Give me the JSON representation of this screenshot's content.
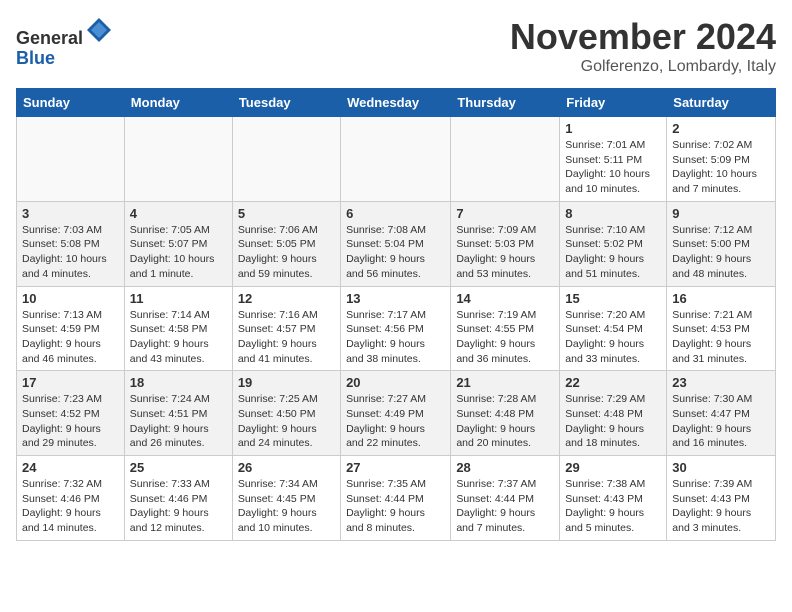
{
  "header": {
    "logo_line1": "General",
    "logo_line2": "Blue",
    "month": "November 2024",
    "location": "Golferenzo, Lombardy, Italy"
  },
  "weekdays": [
    "Sunday",
    "Monday",
    "Tuesday",
    "Wednesday",
    "Thursday",
    "Friday",
    "Saturday"
  ],
  "weeks": [
    [
      {
        "day": "",
        "info": ""
      },
      {
        "day": "",
        "info": ""
      },
      {
        "day": "",
        "info": ""
      },
      {
        "day": "",
        "info": ""
      },
      {
        "day": "",
        "info": ""
      },
      {
        "day": "1",
        "info": "Sunrise: 7:01 AM\nSunset: 5:11 PM\nDaylight: 10 hours\nand 10 minutes."
      },
      {
        "day": "2",
        "info": "Sunrise: 7:02 AM\nSunset: 5:09 PM\nDaylight: 10 hours\nand 7 minutes."
      }
    ],
    [
      {
        "day": "3",
        "info": "Sunrise: 7:03 AM\nSunset: 5:08 PM\nDaylight: 10 hours\nand 4 minutes."
      },
      {
        "day": "4",
        "info": "Sunrise: 7:05 AM\nSunset: 5:07 PM\nDaylight: 10 hours\nand 1 minute."
      },
      {
        "day": "5",
        "info": "Sunrise: 7:06 AM\nSunset: 5:05 PM\nDaylight: 9 hours\nand 59 minutes."
      },
      {
        "day": "6",
        "info": "Sunrise: 7:08 AM\nSunset: 5:04 PM\nDaylight: 9 hours\nand 56 minutes."
      },
      {
        "day": "7",
        "info": "Sunrise: 7:09 AM\nSunset: 5:03 PM\nDaylight: 9 hours\nand 53 minutes."
      },
      {
        "day": "8",
        "info": "Sunrise: 7:10 AM\nSunset: 5:02 PM\nDaylight: 9 hours\nand 51 minutes."
      },
      {
        "day": "9",
        "info": "Sunrise: 7:12 AM\nSunset: 5:00 PM\nDaylight: 9 hours\nand 48 minutes."
      }
    ],
    [
      {
        "day": "10",
        "info": "Sunrise: 7:13 AM\nSunset: 4:59 PM\nDaylight: 9 hours\nand 46 minutes."
      },
      {
        "day": "11",
        "info": "Sunrise: 7:14 AM\nSunset: 4:58 PM\nDaylight: 9 hours\nand 43 minutes."
      },
      {
        "day": "12",
        "info": "Sunrise: 7:16 AM\nSunset: 4:57 PM\nDaylight: 9 hours\nand 41 minutes."
      },
      {
        "day": "13",
        "info": "Sunrise: 7:17 AM\nSunset: 4:56 PM\nDaylight: 9 hours\nand 38 minutes."
      },
      {
        "day": "14",
        "info": "Sunrise: 7:19 AM\nSunset: 4:55 PM\nDaylight: 9 hours\nand 36 minutes."
      },
      {
        "day": "15",
        "info": "Sunrise: 7:20 AM\nSunset: 4:54 PM\nDaylight: 9 hours\nand 33 minutes."
      },
      {
        "day": "16",
        "info": "Sunrise: 7:21 AM\nSunset: 4:53 PM\nDaylight: 9 hours\nand 31 minutes."
      }
    ],
    [
      {
        "day": "17",
        "info": "Sunrise: 7:23 AM\nSunset: 4:52 PM\nDaylight: 9 hours\nand 29 minutes."
      },
      {
        "day": "18",
        "info": "Sunrise: 7:24 AM\nSunset: 4:51 PM\nDaylight: 9 hours\nand 26 minutes."
      },
      {
        "day": "19",
        "info": "Sunrise: 7:25 AM\nSunset: 4:50 PM\nDaylight: 9 hours\nand 24 minutes."
      },
      {
        "day": "20",
        "info": "Sunrise: 7:27 AM\nSunset: 4:49 PM\nDaylight: 9 hours\nand 22 minutes."
      },
      {
        "day": "21",
        "info": "Sunrise: 7:28 AM\nSunset: 4:48 PM\nDaylight: 9 hours\nand 20 minutes."
      },
      {
        "day": "22",
        "info": "Sunrise: 7:29 AM\nSunset: 4:48 PM\nDaylight: 9 hours\nand 18 minutes."
      },
      {
        "day": "23",
        "info": "Sunrise: 7:30 AM\nSunset: 4:47 PM\nDaylight: 9 hours\nand 16 minutes."
      }
    ],
    [
      {
        "day": "24",
        "info": "Sunrise: 7:32 AM\nSunset: 4:46 PM\nDaylight: 9 hours\nand 14 minutes."
      },
      {
        "day": "25",
        "info": "Sunrise: 7:33 AM\nSunset: 4:46 PM\nDaylight: 9 hours\nand 12 minutes."
      },
      {
        "day": "26",
        "info": "Sunrise: 7:34 AM\nSunset: 4:45 PM\nDaylight: 9 hours\nand 10 minutes."
      },
      {
        "day": "27",
        "info": "Sunrise: 7:35 AM\nSunset: 4:44 PM\nDaylight: 9 hours\nand 8 minutes."
      },
      {
        "day": "28",
        "info": "Sunrise: 7:37 AM\nSunset: 4:44 PM\nDaylight: 9 hours\nand 7 minutes."
      },
      {
        "day": "29",
        "info": "Sunrise: 7:38 AM\nSunset: 4:43 PM\nDaylight: 9 hours\nand 5 minutes."
      },
      {
        "day": "30",
        "info": "Sunrise: 7:39 AM\nSunset: 4:43 PM\nDaylight: 9 hours\nand 3 minutes."
      }
    ]
  ]
}
